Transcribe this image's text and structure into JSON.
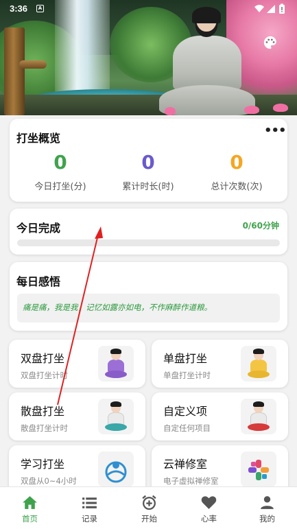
{
  "colors": {
    "accent": "#3fa34d",
    "today_value": "#3fa34d",
    "total_duration": "#6a5acd",
    "total_count": "#f5a623"
  },
  "statusbar": {
    "time": "3:36",
    "notification_icon": "a-notification-icon",
    "icons": [
      "wifi-icon",
      "signal-icon",
      "battery-icon"
    ]
  },
  "header": {
    "palette_icon": "palette-icon"
  },
  "overview": {
    "title": "打坐概览",
    "more_icon": "more-icon",
    "stats": [
      {
        "value": "0",
        "label": "今日打坐(分)"
      },
      {
        "value": "0",
        "label": "累计时长(时)"
      },
      {
        "value": "0",
        "label": "总计次数(次)"
      }
    ]
  },
  "today": {
    "title": "今日完成",
    "progress_text": "0/60分钟",
    "progress": 0.0
  },
  "insight": {
    "title": "每日感悟",
    "quote": "痛是痛，我是我，记忆如露亦如电，不作麻醉作道粮。"
  },
  "tiles": [
    {
      "title": "双盘打坐",
      "subtitle": "双盘打坐计时",
      "icon": "double-lotus-figure-icon"
    },
    {
      "title": "单盘打坐",
      "subtitle": "单盘打坐计时",
      "icon": "single-lotus-figure-icon"
    },
    {
      "title": "散盘打坐",
      "subtitle": "散盘打坐计时",
      "icon": "loose-sit-figure-icon"
    },
    {
      "title": "自定义项",
      "subtitle": "自定任何项目",
      "icon": "custom-figure-icon"
    },
    {
      "title": "学习打坐",
      "subtitle": "双盘从0~4小时",
      "icon": "learn-logo-icon"
    },
    {
      "title": "云禅修室",
      "subtitle": "电子虚拟禅修室",
      "icon": "cloud-zen-logo-icon"
    }
  ],
  "nav": [
    {
      "label": "首页",
      "icon": "home-icon",
      "active": true
    },
    {
      "label": "记录",
      "icon": "list-icon",
      "active": false
    },
    {
      "label": "开始",
      "icon": "alarm-add-icon",
      "active": false
    },
    {
      "label": "心率",
      "icon": "heart-icon",
      "active": false
    },
    {
      "label": "我的",
      "icon": "person-icon",
      "active": false
    }
  ]
}
